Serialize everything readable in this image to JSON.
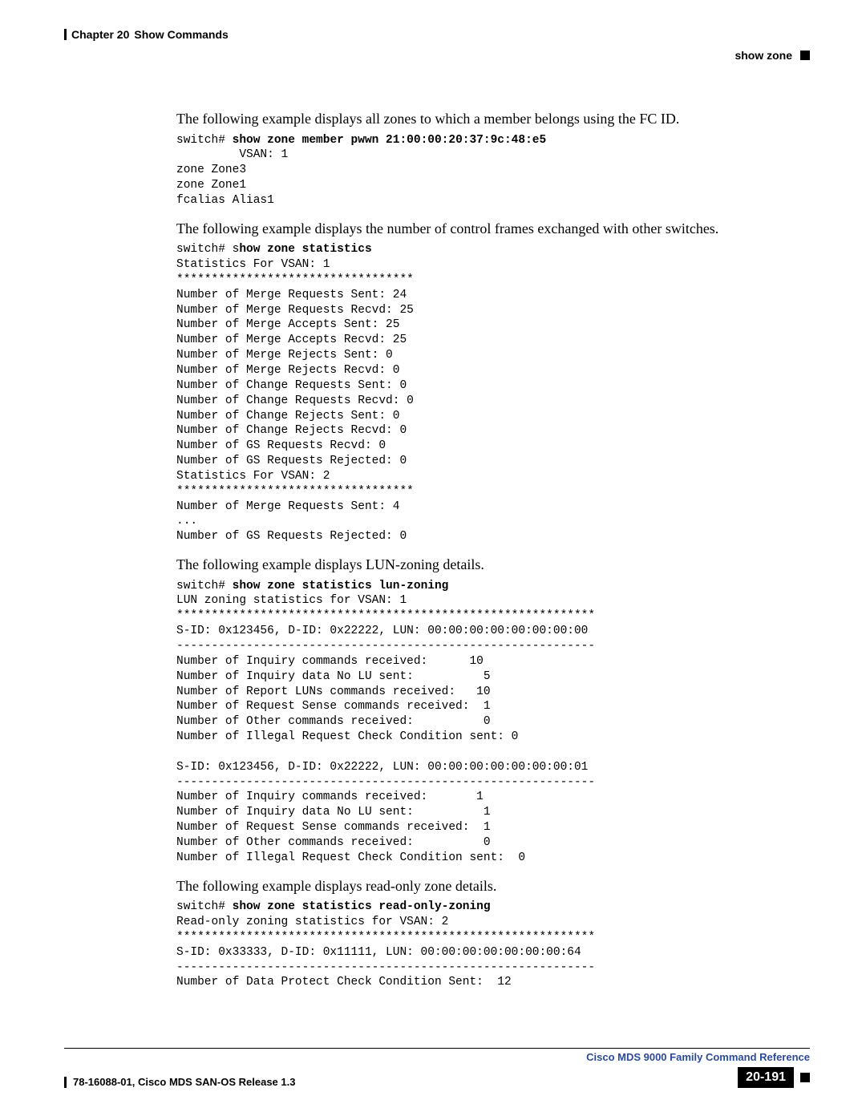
{
  "header": {
    "chapter_label": "Chapter 20",
    "chapter_title": "Show Commands",
    "section": "show zone"
  },
  "s1": {
    "intro": "The following example displays all zones to which a member belongs using the FC ID.",
    "prompt": "switch#",
    "cmd": "show zone member pwwn 21:00:00:20:37:9c:48:e5",
    "out1": "         VSAN: 1",
    "out2": "zone Zone3",
    "out3": "zone Zone1",
    "out4": "fcalias Alias1"
  },
  "s2": {
    "intro": "The following example displays the number of control frames exchanged with other switches.",
    "prompt_pre": "switch# s",
    "cmd": "how zone statistics",
    "l1": "Statistics For VSAN: 1",
    "l2": "**********************************",
    "l3": "Number of Merge Requests Sent: 24",
    "l4": "Number of Merge Requests Recvd: 25",
    "l5": "Number of Merge Accepts Sent: 25",
    "l6": "Number of Merge Accepts Recvd: 25",
    "l7": "Number of Merge Rejects Sent: 0",
    "l8": "Number of Merge Rejects Recvd: 0",
    "l9": "Number of Change Requests Sent: 0",
    "l10": "Number of Change Requests Recvd: 0",
    "l11": "Number of Change Rejects Sent: 0",
    "l12": "Number of Change Rejects Recvd: 0",
    "l13": "Number of GS Requests Recvd: 0",
    "l14": "Number of GS Requests Rejected: 0",
    "l15": "Statistics For VSAN: 2",
    "l16": "**********************************",
    "l17": "Number of Merge Requests Sent: 4",
    "l18": "...",
    "l19": "Number of GS Requests Rejected: 0"
  },
  "s3": {
    "intro": "The following example displays LUN-zoning details.",
    "prompt": "switch#",
    "cmd": "show zone statistics lun-zoning",
    "l1": "LUN zoning statistics for VSAN: 1",
    "l2": "************************************************************",
    "l3": "S-ID: 0x123456, D-ID: 0x22222, LUN: 00:00:00:00:00:00:00:00",
    "l4": "------------------------------------------------------------",
    "l5": "Number of Inquiry commands received:      10",
    "l6": "Number of Inquiry data No LU sent:          5",
    "l7": "Number of Report LUNs commands received:   10",
    "l8": "Number of Request Sense commands received:  1",
    "l9": "Number of Other commands received:          0",
    "l10": "Number of Illegal Request Check Condition sent: 0",
    "l11": "",
    "l12": "S-ID: 0x123456, D-ID: 0x22222, LUN: 00:00:00:00:00:00:00:01",
    "l13": "------------------------------------------------------------",
    "l14": "Number of Inquiry commands received:       1",
    "l15": "Number of Inquiry data No LU sent:          1",
    "l16": "Number of Request Sense commands received:  1",
    "l17": "Number of Other commands received:          0",
    "l18": "Number of Illegal Request Check Condition sent:  0"
  },
  "s4": {
    "intro": "The following example displays read-only zone details.",
    "prompt": "switch#",
    "cmd": "show zone statistics read-only-zoning",
    "l1": "Read-only zoning statistics for VSAN: 2",
    "l2": "************************************************************",
    "l3": "S-ID: 0x33333, D-ID: 0x11111, LUN: 00:00:00:00:00:00:00:64",
    "l4": "------------------------------------------------------------",
    "l5": "Number of Data Protect Check Condition Sent:  12"
  },
  "footer": {
    "title": "Cisco MDS 9000 Family Command Reference",
    "left": "78-16088-01, Cisco MDS SAN-OS Release 1.3",
    "page": "20-191"
  }
}
